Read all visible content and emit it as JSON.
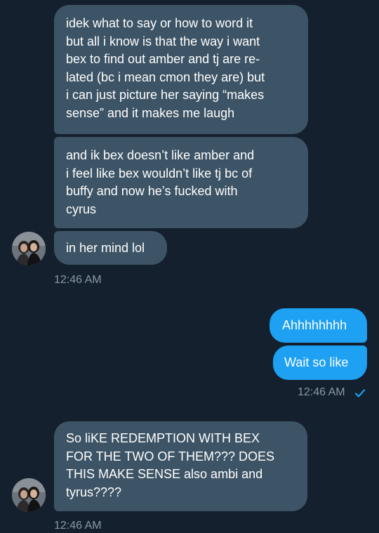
{
  "conversation": {
    "messages": [
      {
        "direction": "incoming",
        "text": "idek what to say or how to word it\nbut all i know is that the way i want\nbex to find out amber and tj are re-\nlated (bc i mean cmon they are) but\ni can just picture her saying “makes\nsense” and it makes me laugh"
      },
      {
        "direction": "incoming",
        "text": "and ik bex doesn’t like amber and\ni feel like bex wouldn’t like tj bc of\nbuffy and now he’s fucked with\ncyrus"
      },
      {
        "direction": "incoming",
        "text": "in her mind lol"
      },
      {
        "direction": "outgoing",
        "text": "Ahhhhhhhh"
      },
      {
        "direction": "outgoing",
        "text": "Wait so like"
      },
      {
        "direction": "incoming",
        "text": "So liKE REDEMPTION WITH BEX\nFOR THE TWO OF THEM??? DOES\nTHIS MAKE SENSE also ambi and\ntyrus????"
      }
    ],
    "timestamps": {
      "group_1": "12:46 AM",
      "group_2": "12:46 AM",
      "group_3": "12:46 AM"
    },
    "read_status": "sent",
    "icons": {
      "avatar": "avatar",
      "read_receipt": "check-icon"
    },
    "colors": {
      "background": "#14202d",
      "incoming_bubble": "#3d5466",
      "outgoing_bubble": "#1ea1f2",
      "timestamp": "#8899a6",
      "check": "#1da1f2"
    }
  }
}
